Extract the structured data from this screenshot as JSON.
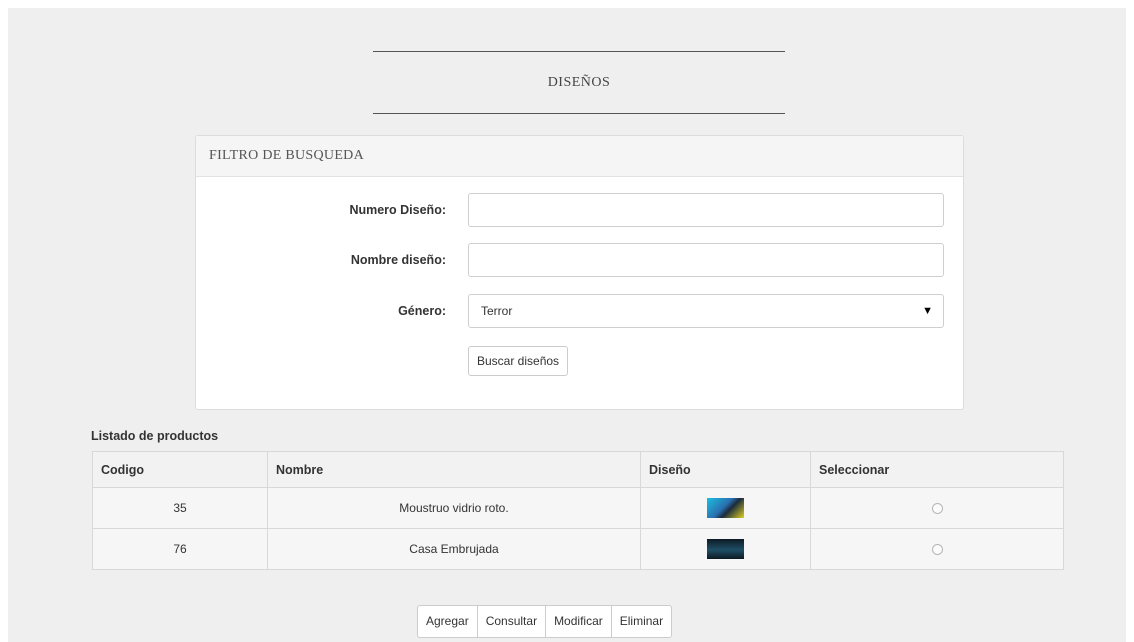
{
  "page": {
    "title": "DISEÑOS"
  },
  "filter": {
    "heading": "FILTRO DE BUSQUEDA",
    "numero_label": "Numero Diseño:",
    "numero_value": "",
    "nombre_label": "Nombre diseño:",
    "nombre_value": "",
    "genero_label": "Género:",
    "genero_selected": "Terror",
    "search_button": "Buscar diseños"
  },
  "list": {
    "caption": "Listado de productos",
    "columns": [
      "Codigo",
      "Nombre",
      "Diseño",
      "Seleccionar"
    ],
    "rows": [
      {
        "codigo": "35",
        "nombre": "Moustruo vidrio roto.",
        "diseno_icon": "design-thumbnail-monster-icon",
        "selected": false
      },
      {
        "codigo": "76",
        "nombre": "Casa Embrujada",
        "diseno_icon": "design-thumbnail-haunted-house-icon",
        "selected": false
      }
    ]
  },
  "actions": {
    "agregar": "Agregar",
    "consultar": "Consultar",
    "modificar": "Modificar",
    "eliminar": "Eliminar"
  }
}
